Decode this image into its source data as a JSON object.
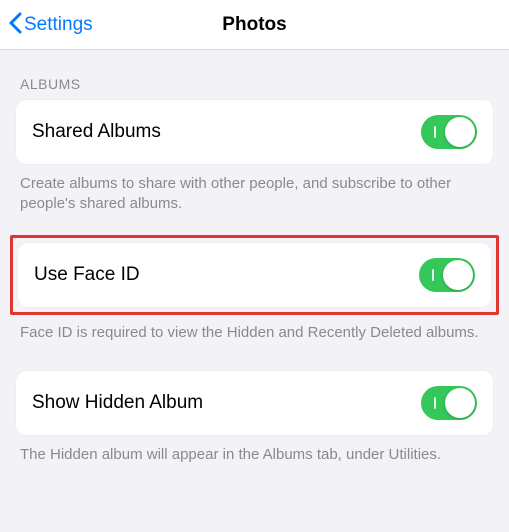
{
  "nav": {
    "back_label": "Settings",
    "title": "Photos"
  },
  "section": {
    "header": "ALBUMS"
  },
  "shared_albums": {
    "label": "Shared Albums",
    "footer": "Create albums to share with other people, and subscribe to other people's shared albums.",
    "on": true
  },
  "face_id": {
    "label": "Use Face ID",
    "footer": "Face ID is required to view the Hidden and Recently Deleted albums.",
    "on": true
  },
  "hidden_album": {
    "label": "Show Hidden Album",
    "footer": "The Hidden album will appear in the Albums tab, under Utilities.",
    "on": true
  }
}
